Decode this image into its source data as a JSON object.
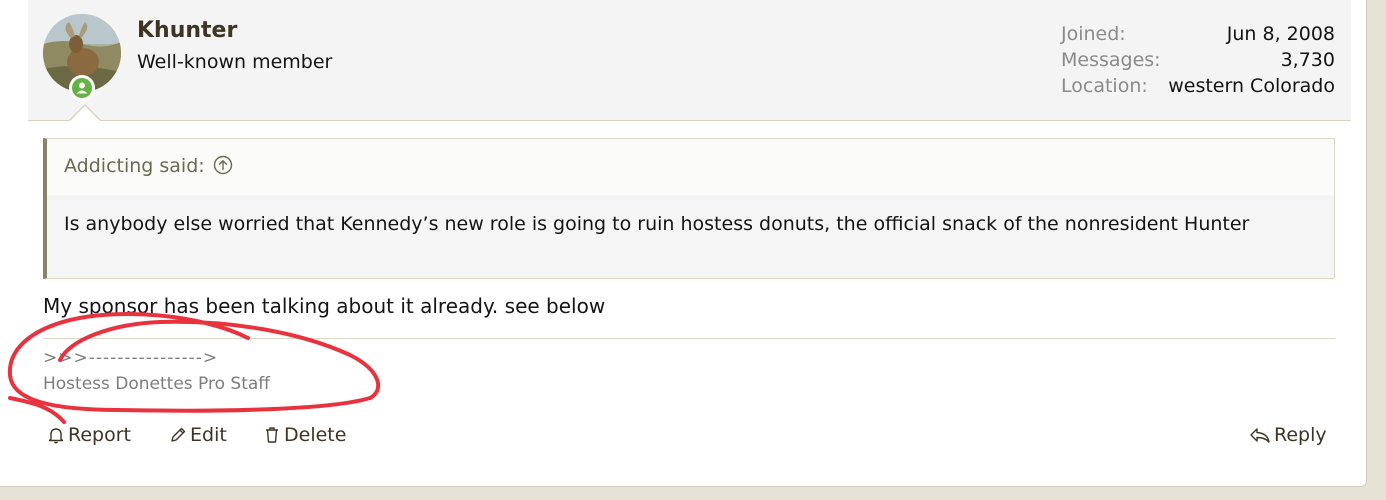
{
  "user": {
    "name": "Khunter",
    "title": "Well-known member",
    "online": true,
    "stats": [
      {
        "label": "Joined:",
        "value": "Jun 8, 2008"
      },
      {
        "label": "Messages:",
        "value": "3,730"
      },
      {
        "label": "Location:",
        "value": "western Colorado"
      }
    ]
  },
  "quote": {
    "author": "Addicting said:",
    "body": "Is anybody else worried that Kennedy’s new role is going to ruin hostess donuts, the official snack of the nonresident Hunter"
  },
  "post": {
    "message": "My sponsor has been talking about it already. see below"
  },
  "signature": {
    "line1": ">>>---------------->",
    "line2": "Hostess Donettes Pro Staff"
  },
  "actions": {
    "report": "Report",
    "edit": "Edit",
    "delete": "Delete",
    "reply": "Reply"
  },
  "colors": {
    "background": "#e6e3d6",
    "username": "#3d3424",
    "quote_border": "#8a8466",
    "online": "#63b344",
    "annotation": "#e8333f"
  },
  "icons": {
    "quote_jump": "arrow-up-circle-icon",
    "report": "bell-icon",
    "edit": "pencil-icon",
    "delete": "trash-icon",
    "reply": "reply-arrow-icon",
    "online": "user-online-icon"
  }
}
